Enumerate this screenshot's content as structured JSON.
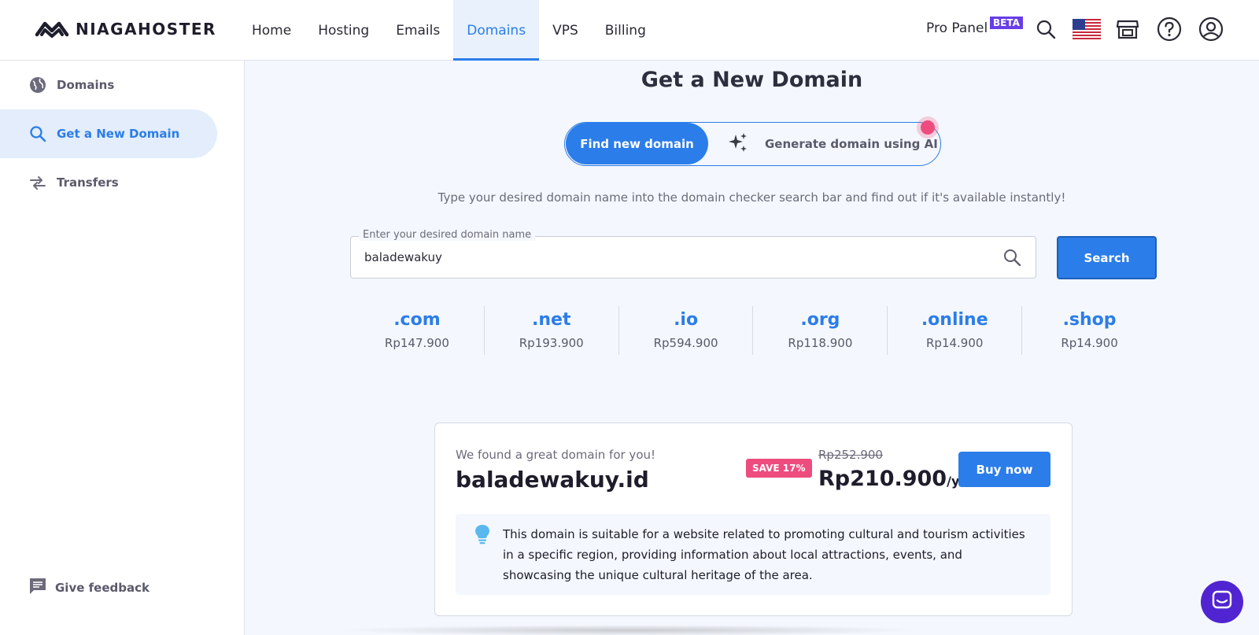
{
  "brand": {
    "name": "NIAGAHOSTER"
  },
  "nav": [
    {
      "label": "Home",
      "active": false
    },
    {
      "label": "Hosting",
      "active": false
    },
    {
      "label": "Emails",
      "active": false
    },
    {
      "label": "Domains",
      "active": true
    },
    {
      "label": "VPS",
      "active": false
    },
    {
      "label": "Billing",
      "active": false
    }
  ],
  "header": {
    "pro_panel": "Pro Panel",
    "beta": "BETA",
    "icons": [
      "search-icon",
      "us-flag-icon",
      "store-icon",
      "help-icon",
      "account-icon"
    ]
  },
  "sidebar": {
    "items": [
      {
        "label": "Domains",
        "icon": "globe-icon",
        "active": false
      },
      {
        "label": "Get a New Domain",
        "icon": "search-icon",
        "active": true
      },
      {
        "label": "Transfers",
        "icon": "transfer-icon",
        "active": false
      }
    ],
    "feedback": "Give feedback"
  },
  "main": {
    "title": "Get a New Domain",
    "toggle": {
      "find": "Find new domain",
      "ai": "Generate domain using AI"
    },
    "subtitle": "Type your desired domain name into the domain checker search bar and find out if it's available instantly!",
    "search": {
      "label": "Enter your desired domain name",
      "value": "baladewakuy",
      "button": "Search"
    },
    "tlds": [
      {
        "name": ".com",
        "price": "Rp147.900"
      },
      {
        "name": ".net",
        "price": "Rp193.900"
      },
      {
        "name": ".io",
        "price": "Rp594.900"
      },
      {
        "name": ".org",
        "price": "Rp118.900"
      },
      {
        "name": ".online",
        "price": "Rp14.900"
      },
      {
        "name": ".shop",
        "price": "Rp14.900"
      }
    ],
    "suggestion": {
      "found_text": "We found a great domain for you!",
      "domain": "baladewakuy.id",
      "badge": "SAVE 17%",
      "old_price": "Rp252.900",
      "new_price": "Rp210.900",
      "per": "/yr",
      "buy": "Buy now",
      "info": "This domain is suitable for a website related to promoting cultural and tourism activities in a specific region, providing information about local attractions, events, and showcasing the unique cultural heritage of the area."
    }
  },
  "colors": {
    "accent": "#2b7de9",
    "badge": "#ee4c7e",
    "beta": "#673de6",
    "chat": "#5025d1"
  }
}
